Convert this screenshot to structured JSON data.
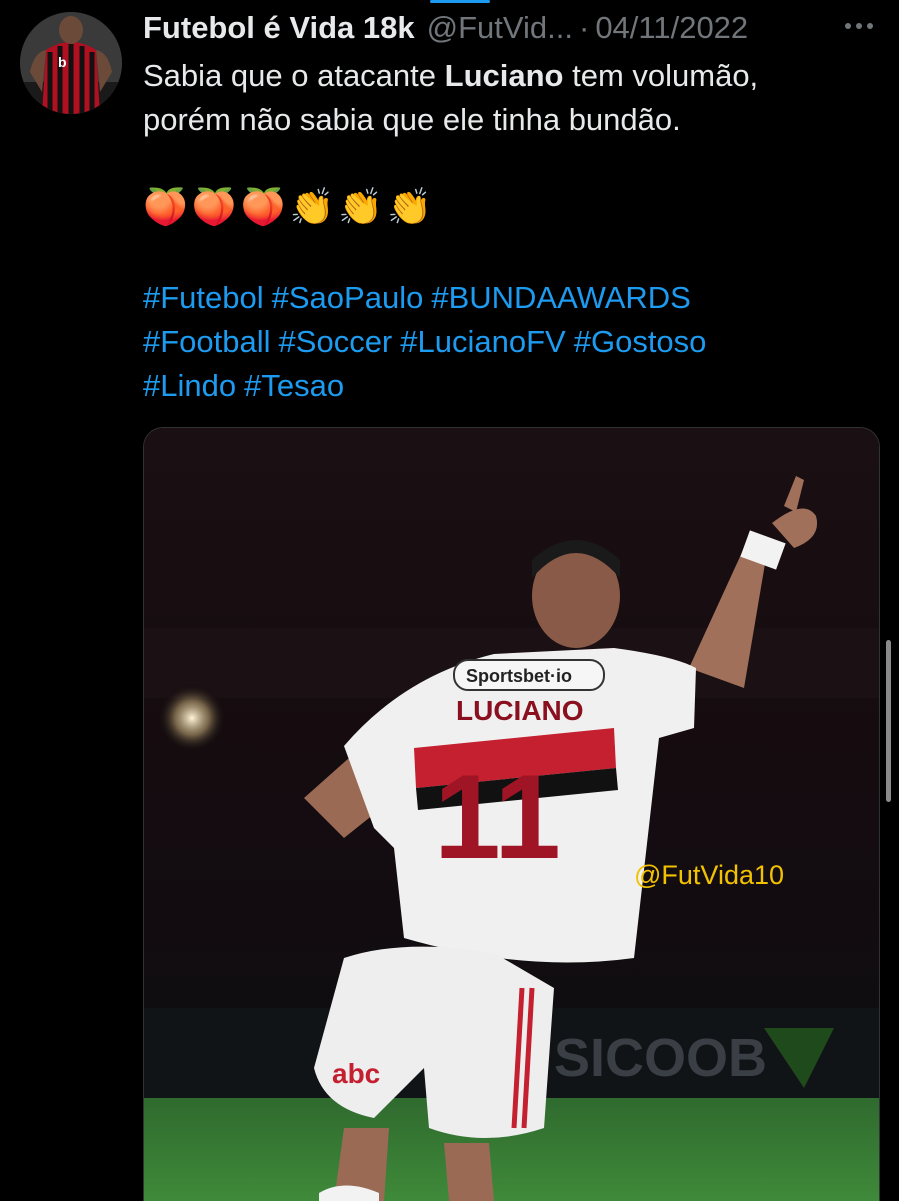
{
  "tweet": {
    "display_name": "Futebol é Vida 18k",
    "handle": "@FutVid...",
    "separator": "·",
    "date": "04/11/2022",
    "text_before": "Sabia que o atacante ",
    "text_bold": "Luciano",
    "text_after": " tem volumão,",
    "text_line2": "porém não sabia que ele tinha bundão.",
    "emojis": [
      "🍑",
      "🍑",
      "🍑",
      "👏",
      "👏",
      "👏"
    ],
    "hashtags_line1": [
      "#Futebol",
      "#SaoPaulo",
      "#BUNDAAWARDS"
    ],
    "hashtags_line2": [
      "#Football",
      "#Soccer",
      "#LucianoFV",
      "#Gostoso"
    ],
    "hashtags_line3": [
      "#Lindo",
      "#Tesao"
    ]
  },
  "media": {
    "watermark": "@FutVida10",
    "jersey_name": "LUCIANO",
    "jersey_number": "11",
    "sponsor_top": "Sportsbet·io",
    "shorts_sponsor": "abc",
    "board_text": "SICOOB"
  },
  "icons": {
    "more": "more-horizontal-icon"
  },
  "colors": {
    "accent": "#1d9bf0",
    "muted": "#71767b",
    "watermark": "#f2c200"
  }
}
